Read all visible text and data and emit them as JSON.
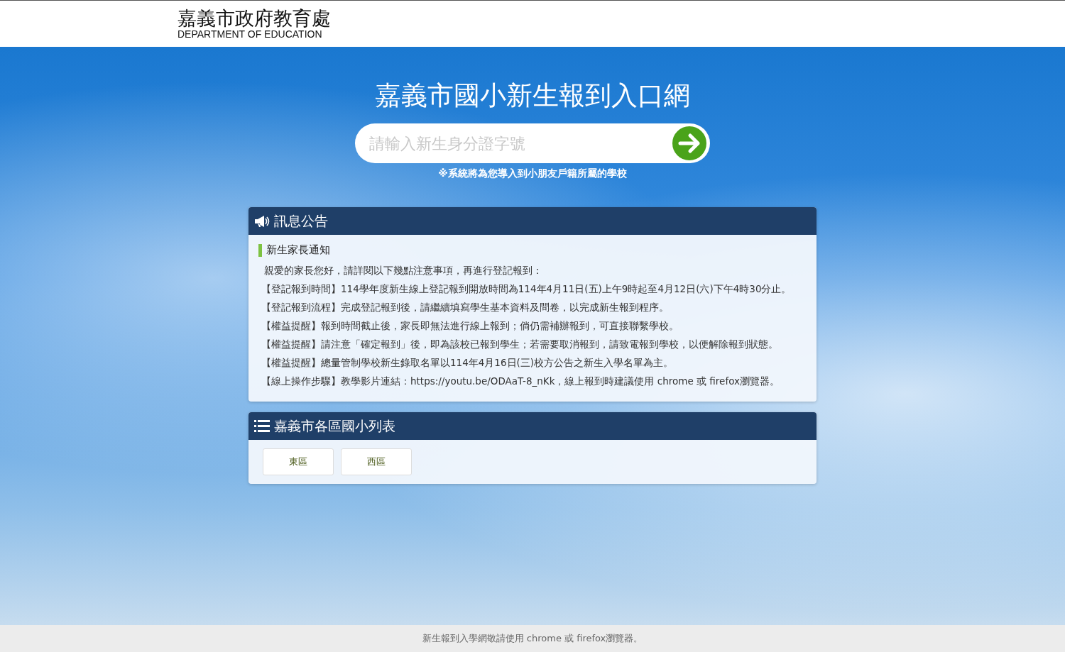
{
  "header": {
    "title": "嘉義市政府教育處",
    "subtitle": "DEPARTMENT OF EDUCATION"
  },
  "hero": {
    "title": "嘉義市國小新生報到入口網",
    "search": {
      "placeholder": "請輸入新生身分證字號"
    },
    "hint": "※系統將為您導入到小朋友戶籍所屬的學校"
  },
  "announcements": {
    "title": "訊息公告",
    "section_title": "新生家長通知",
    "lines": [
      "親愛的家長您好，請詳閱以下幾點注意事項，再進行登記報到：",
      "【登記報到時間】114學年度新生線上登記報到開放時間為114年4月11日(五)上午9時起至4月12日(六)下午4時30分止。",
      "【登記報到流程】完成登記報到後，請繼續填寫學生基本資料及問卷，以完成新生報到程序。",
      "【權益提醒】報到時間截止後，家長即無法進行線上報到；倘仍需補辦報到，可直接聯繫學校。",
      "【權益提醒】請注意「確定報到」後，即為該校已報到學生；若需要取消報到，請致電報到學校，以便解除報到狀態。",
      "【權益提醒】總量管制學校新生錄取名單以114年4月16日(三)校方公告之新生入學名單為主。",
      "【線上操作步驟】教學影片連結：https://youtu.be/ODAaT-8_nKk，線上報到時建議使用 chrome 或 firefox瀏覽器。"
    ]
  },
  "school_list": {
    "title": "嘉義市各區國小列表",
    "districts": [
      "東區",
      "西區"
    ]
  },
  "footer": "新生報到入學網敬請使用 chrome 或 firefox瀏覽器。"
}
